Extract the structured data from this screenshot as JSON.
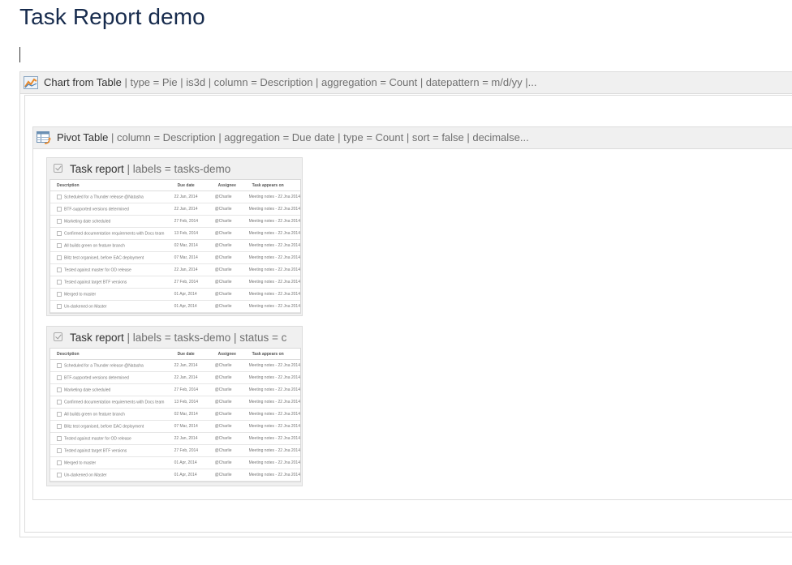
{
  "page": {
    "title": "Task Report demo"
  },
  "chart_macro": {
    "name": "Chart from Table",
    "params": " | type = Pie | is3d | column = Description | aggregation = Count | datepattern = m/d/yy |..."
  },
  "pivot_macro": {
    "name": "Pivot Table",
    "params": " | column = Description | aggregation = Due date | type = Count | sort = false | decimalse..."
  },
  "task_reports": [
    {
      "name": "Task report",
      "params": " | labels = tasks-demo",
      "columns": [
        "Description",
        "Due date",
        "Assignee",
        "Task appears on"
      ],
      "rows": [
        [
          "Scheduled for a Thunder release @Natasha",
          "22 Jan, 2014",
          "@Charlie",
          "Meeting notes - 22 Jna 2014"
        ],
        [
          "BTF-supported versions determined",
          "22 Jan, 2014",
          "@Charlie",
          "Meeting notes - 22 Jna 2014"
        ],
        [
          "Marketing date scheduled",
          "27 Feb, 2014",
          "@Charlie",
          "Meeting notes - 22 Jna 2014"
        ],
        [
          "Confirmed documentation requirements with Docs team",
          "13 Feb, 2014",
          "@Charlie",
          "Meeting notes - 22 Jna 2014"
        ],
        [
          "All builds green on feature branch",
          "02 Mar, 2014",
          "@Charlie",
          "Meeting notes - 22 Jna 2014"
        ],
        [
          "Blitz test organised, before EAC deployment",
          "07 Mar, 2014",
          "@Charlie",
          "Meeting notes - 22 Jna 2014"
        ],
        [
          "Tested against master for OD release",
          "22 Jan, 2014",
          "@Charlie",
          "Meeting notes - 22 Jna 2014"
        ],
        [
          "Tested against target BTF versions",
          "27 Feb, 2014",
          "@Charlie",
          "Meeting notes - 22 Jna 2014"
        ],
        [
          "Merged to master",
          "01 Apr, 2014",
          "@Charlie",
          "Meeting notes - 22 Jna 2014"
        ],
        [
          "Un-darkened on Master",
          "01 Apr, 2014",
          "@Charlie",
          "Meeting notes - 22 Jna 2014"
        ]
      ]
    },
    {
      "name": "Task report",
      "params": " | labels = tasks-demo | status = c",
      "columns": [
        "Description",
        "Due date",
        "Assignee",
        "Task appears on"
      ],
      "rows": [
        [
          "Scheduled for a Thunder release @Natasha",
          "22 Jan, 2014",
          "@Charlie",
          "Meeting notes - 22 Jna 2014"
        ],
        [
          "BTF-supported versions determined",
          "22 Jan, 2014",
          "@Charlie",
          "Meeting notes - 22 Jna 2014"
        ],
        [
          "Marketing date scheduled",
          "27 Feb, 2014",
          "@Charlie",
          "Meeting notes - 22 Jna 2014"
        ],
        [
          "Confirmed documentation requirements with Docs team",
          "13 Feb, 2014",
          "@Charlie",
          "Meeting notes - 22 Jna 2014"
        ],
        [
          "All builds green on feature branch",
          "02 Mar, 2014",
          "@Charlie",
          "Meeting notes - 22 Jna 2014"
        ],
        [
          "Blitz test organised, before EAC deployment",
          "07 Mar, 2014",
          "@Charlie",
          "Meeting notes - 22 Jna 2014"
        ],
        [
          "Tested against master for OD release",
          "22 Jan, 2014",
          "@Charlie",
          "Meeting notes - 22 Jna 2014"
        ],
        [
          "Tested against target BTF versions",
          "27 Feb, 2014",
          "@Charlie",
          "Meeting notes - 22 Jna 2014"
        ],
        [
          "Merged to master",
          "01 Apr, 2014",
          "@Charlie",
          "Meeting notes - 22 Jna 2014"
        ],
        [
          "Un-darkened on Master",
          "01 Apr, 2014",
          "@Charlie",
          "Meeting notes - 22 Jna 2014"
        ]
      ]
    }
  ],
  "icons": {
    "chart": "chart-macro-icon",
    "pivot": "pivot-table-macro-icon",
    "task": "checkbox-icon"
  }
}
